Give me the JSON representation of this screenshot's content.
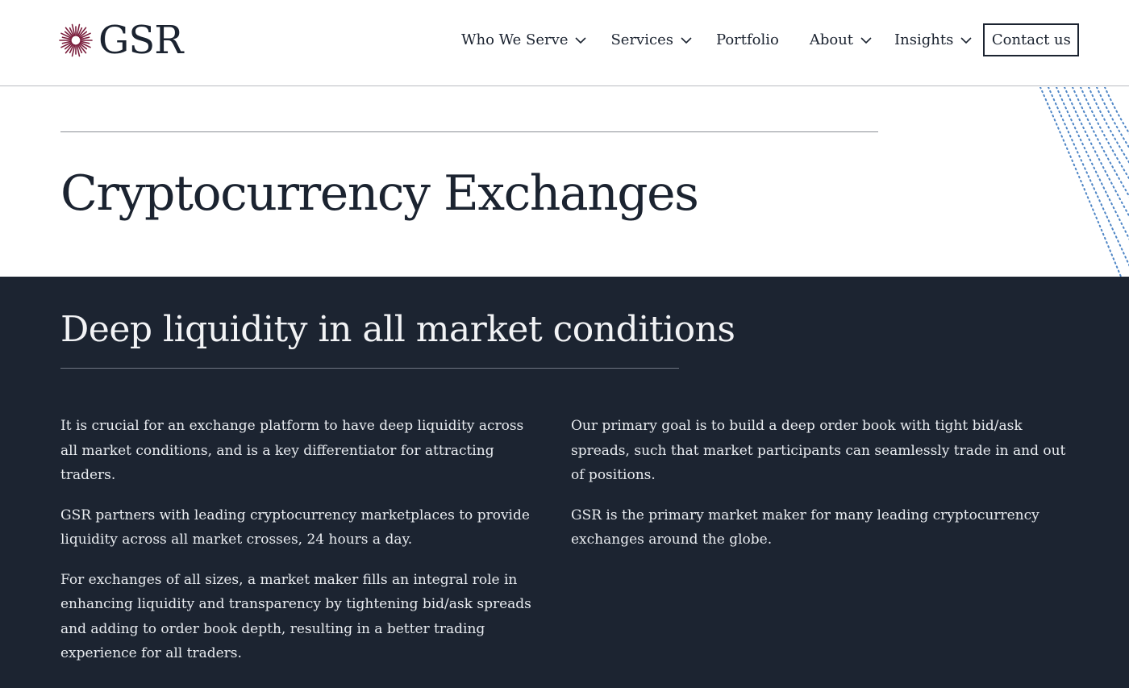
{
  "header": {
    "logo_text": "GSR",
    "nav": [
      {
        "label": "Who We Serve",
        "has_dropdown": true
      },
      {
        "label": "Services",
        "has_dropdown": true
      },
      {
        "label": "Portfolio",
        "has_dropdown": false
      },
      {
        "label": "About",
        "has_dropdown": true
      },
      {
        "label": "Insights",
        "has_dropdown": true
      }
    ],
    "contact_label": "Contact us"
  },
  "hero": {
    "title": "Cryptocurrency Exchanges"
  },
  "section": {
    "heading": "Deep liquidity in all market conditions",
    "left_paragraphs": [
      "It is crucial for an exchange platform to have deep liquidity across all market conditions, and is a key differentiator for attracting traders.",
      "GSR partners with leading cryptocurrency marketplaces to provide liquidity across all market crosses, 24 hours a day.",
      "For exchanges of all sizes, a market maker fills an integral role in enhancing liquidity and transparency by tightening bid/ask spreads and adding to order book depth, resulting in a better trading experience for all traders."
    ],
    "right_paragraphs": [
      "Our primary goal is to build a deep order book with tight bid/ask spreads, such that market participants can seamlessly trade in and out of positions.",
      "GSR is the primary market maker for many leading cryptocurrency exchanges around the globe."
    ]
  },
  "colors": {
    "brand_mark": "#7a1e3c",
    "dark_bg": "#1c2431",
    "text_dark": "#1b2330",
    "deco_dots": "#4f86c6"
  },
  "icons": {
    "logo_mark": "starburst-icon",
    "dropdown": "chevron-down-icon"
  }
}
